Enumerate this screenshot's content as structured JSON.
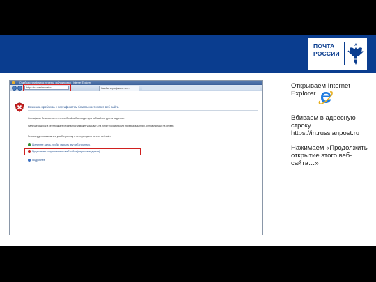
{
  "logo": {
    "line1": "ПОЧТА",
    "line2": "РОССИИ"
  },
  "browser": {
    "window_title": "Ошибка сертификата: переход заблокирован - Internet Explorer",
    "url": "https://ru.russianpost.ru",
    "tab_label": "Ошибка сертификата: пер..."
  },
  "cert_page": {
    "title": "Возникла проблема с сертификатом безопасности этого веб-сайта.",
    "p1": "Сертификат безопасности этого веб-сайта был выдан для веб-сайта с другим адресом.",
    "p2": "Наличие ошибок в сертификате безопасности может указывать на попытку обмана или перехвата данных, отправляемых на сервер.",
    "p3": "Рекомендуется закрыть эту веб-страницу и не переходить на этот веб-сайт.",
    "opt_close": "Щелкните здесь, чтобы закрыть эту веб-страницу.",
    "opt_continue": "Продолжить открытие этого веб-сайта (не рекомендуется).",
    "opt_details": "Подробнее"
  },
  "bullets": {
    "b1": "Открываем Internet Explorer",
    "b2_text": "Вбиваем в адресную строку",
    "b2_link": "https://in.russianpost.ru",
    "b3": "Нажимаем «Продолжить открытие этого веб-сайта…»"
  },
  "colors": {
    "accent": "#0a3d8f",
    "highlight": "#d0201f"
  },
  "icons": [
    "ie-logo-icon",
    "cert-error-shield-icon",
    "post-emblem-icon"
  ]
}
